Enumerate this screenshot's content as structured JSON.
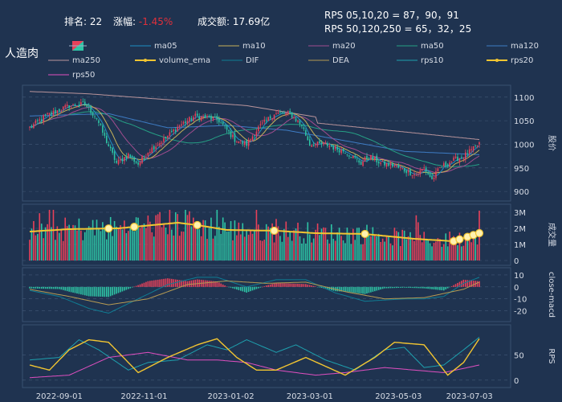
{
  "header": {
    "rank_label": "排名:",
    "rank_value": "22",
    "change_label": "涨幅:",
    "change_value": "-1.45%",
    "turnover_label": "成交额:",
    "turnover_value": "17.69亿",
    "rps_line1": "RPS 05,10,20 = 87，90，91",
    "rps_line2": "RPS 50,120,250 = 65，32，25"
  },
  "title": "人造肉",
  "colors": {
    "background": "#1f3350",
    "up": "#e8415a",
    "down": "#2ec4a5",
    "ma05": "#1e8fc4",
    "ma10": "#c7b25a",
    "ma20": "#a24d8f",
    "ma50": "#26a085",
    "ma120": "#3e7cc4",
    "ma250": "#b9949b",
    "volume_ema": "#f2c531",
    "dif": "#0f7d94",
    "dea": "#b69a52",
    "rps10": "#1ea0ae",
    "rps20": "#f2c531",
    "rps50": "#e04fc0"
  },
  "chart_data": {
    "type": "line",
    "x_labels": [
      "2022-09-01",
      "2022-11-01",
      "2023-01-02",
      "2023-03-01",
      "2023-05-03",
      "2023-07-03"
    ],
    "legend": [
      "ma05",
      "ma10",
      "ma20",
      "ma50",
      "ma120",
      "ma250",
      "volume_ema",
      "DIF",
      "DEA",
      "rps10",
      "rps20",
      "rps50"
    ],
    "panels": [
      {
        "name": "price",
        "ylabel": "股价",
        "yticks": [
          900,
          950,
          1000,
          1050,
          1100
        ],
        "ylim": [
          890,
          1115
        ],
        "close_anchors": [
          [
            0,
            1035
          ],
          [
            8,
            1060
          ],
          [
            20,
            1082
          ],
          [
            28,
            1085
          ],
          [
            34,
            1055
          ],
          [
            38,
            1015
          ],
          [
            44,
            960
          ],
          [
            50,
            978
          ],
          [
            55,
            958
          ],
          [
            60,
            985
          ],
          [
            68,
            1010
          ],
          [
            76,
            1040
          ],
          [
            84,
            1060
          ],
          [
            92,
            1055
          ],
          [
            96,
            1050
          ],
          [
            100,
            1030
          ],
          [
            104,
            1010
          ],
          [
            110,
            1000
          ],
          [
            116,
            1035
          ],
          [
            124,
            1065
          ],
          [
            132,
            1065
          ],
          [
            138,
            1040
          ],
          [
            142,
            1000
          ],
          [
            150,
            1000
          ],
          [
            156,
            990
          ],
          [
            160,
            985
          ],
          [
            168,
            960
          ],
          [
            172,
            975
          ],
          [
            178,
            960
          ],
          [
            184,
            955
          ],
          [
            190,
            945
          ],
          [
            196,
            935
          ],
          [
            200,
            950
          ],
          [
            204,
            925
          ],
          [
            208,
            950
          ],
          [
            214,
            965
          ],
          [
            220,
            975
          ],
          [
            225,
            990
          ],
          [
            228,
            1002
          ]
        ],
        "ma250_anchors": [
          [
            0,
            1112
          ],
          [
            30,
            1107
          ],
          [
            110,
            1082
          ],
          [
            145,
            1058
          ],
          [
            146,
            1045
          ],
          [
            200,
            1022
          ],
          [
            228,
            1010
          ]
        ],
        "ma120_anchors": [
          [
            0,
            1060
          ],
          [
            40,
            1065
          ],
          [
            70,
            1035
          ],
          [
            100,
            1040
          ],
          [
            130,
            1030
          ],
          [
            150,
            1015
          ],
          [
            190,
            985
          ],
          [
            228,
            978
          ]
        ]
      },
      {
        "name": "volume",
        "ylabel": "成交量",
        "yticks": [
          "0",
          "1M",
          "2M",
          "3M"
        ],
        "ylim": [
          0,
          3200000
        ],
        "volume_ema_anchors": [
          [
            0,
            1.8
          ],
          [
            20,
            1.95
          ],
          [
            45,
            2.0
          ],
          [
            75,
            2.35
          ],
          [
            85,
            2.2
          ],
          [
            100,
            1.9
          ],
          [
            125,
            1.85
          ],
          [
            145,
            1.7
          ],
          [
            170,
            1.65
          ],
          [
            195,
            1.35
          ],
          [
            215,
            1.2
          ],
          [
            228,
            1.7
          ]
        ],
        "marker_indices": [
          40,
          53,
          85,
          124,
          170,
          215,
          218,
          222,
          225,
          228
        ]
      },
      {
        "name": "macd",
        "ylabel": "close-macd",
        "yticks": [
          10,
          0,
          -10,
          -20
        ],
        "ylim": [
          -25,
          12
        ],
        "dif_anchors": [
          [
            0,
            -3
          ],
          [
            15,
            -8
          ],
          [
            30,
            -18
          ],
          [
            40,
            -22
          ],
          [
            55,
            -10
          ],
          [
            70,
            2
          ],
          [
            85,
            8
          ],
          [
            95,
            8
          ],
          [
            110,
            0
          ],
          [
            125,
            6
          ],
          [
            140,
            6
          ],
          [
            155,
            -5
          ],
          [
            170,
            -12
          ],
          [
            190,
            -10
          ],
          [
            200,
            -10
          ],
          [
            210,
            -8
          ],
          [
            220,
            3
          ],
          [
            228,
            8
          ]
        ],
        "dea_anchors": [
          [
            0,
            -2
          ],
          [
            20,
            -8
          ],
          [
            40,
            -15
          ],
          [
            60,
            -10
          ],
          [
            80,
            2
          ],
          [
            100,
            5
          ],
          [
            120,
            3
          ],
          [
            140,
            4
          ],
          [
            160,
            -4
          ],
          [
            180,
            -10
          ],
          [
            200,
            -9
          ],
          [
            220,
            -2
          ],
          [
            228,
            4
          ]
        ]
      },
      {
        "name": "rps",
        "ylabel": "RPS",
        "yticks": [
          0,
          50
        ],
        "ylim": [
          -5,
          100
        ],
        "rps10_anchors": [
          [
            0,
            40
          ],
          [
            15,
            45
          ],
          [
            25,
            80
          ],
          [
            35,
            60
          ],
          [
            50,
            20
          ],
          [
            60,
            35
          ],
          [
            75,
            40
          ],
          [
            90,
            70
          ],
          [
            100,
            60
          ],
          [
            110,
            80
          ],
          [
            125,
            55
          ],
          [
            135,
            70
          ],
          [
            150,
            40
          ],
          [
            165,
            20
          ],
          [
            180,
            60
          ],
          [
            190,
            65
          ],
          [
            200,
            25
          ],
          [
            210,
            30
          ],
          [
            220,
            60
          ],
          [
            228,
            85
          ]
        ],
        "rps20_anchors": [
          [
            0,
            30
          ],
          [
            10,
            20
          ],
          [
            20,
            60
          ],
          [
            30,
            80
          ],
          [
            40,
            75
          ],
          [
            55,
            15
          ],
          [
            70,
            45
          ],
          [
            85,
            70
          ],
          [
            95,
            82
          ],
          [
            105,
            45
          ],
          [
            115,
            20
          ],
          [
            125,
            20
          ],
          [
            140,
            45
          ],
          [
            160,
            10
          ],
          [
            175,
            45
          ],
          [
            185,
            75
          ],
          [
            200,
            70
          ],
          [
            212,
            10
          ],
          [
            220,
            35
          ],
          [
            228,
            82
          ]
        ],
        "rps50_anchors": [
          [
            0,
            5
          ],
          [
            20,
            10
          ],
          [
            40,
            45
          ],
          [
            60,
            55
          ],
          [
            80,
            40
          ],
          [
            95,
            40
          ],
          [
            110,
            35
          ],
          [
            125,
            20
          ],
          [
            145,
            10
          ],
          [
            160,
            15
          ],
          [
            180,
            25
          ],
          [
            195,
            20
          ],
          [
            210,
            15
          ],
          [
            222,
            25
          ],
          [
            228,
            30
          ]
        ]
      }
    ]
  }
}
